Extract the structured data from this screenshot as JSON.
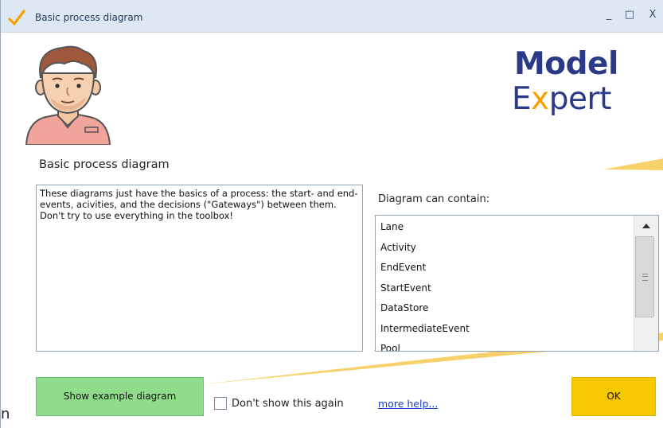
{
  "window": {
    "title": "Basic process diagram",
    "controls": {
      "minimize": "_",
      "maximize": "□",
      "close": "X"
    }
  },
  "logo": {
    "line1": "Model",
    "line2": "Expert",
    "text_color": "#2b3a86",
    "accent_color": "#f5a300"
  },
  "main": {
    "heading": "Basic process diagram",
    "description": "These diagrams just have the basics of a process: the start- and end-events, acivities, and the decisions (\"Gateways\") between them. Don't try to use everything in the toolbox!",
    "contain_label": "Diagram can contain:",
    "contain_items": [
      "Lane",
      "Activity",
      "EndEvent",
      "StartEvent",
      "DataStore",
      "IntermediateEvent",
      "Pool"
    ]
  },
  "footer": {
    "example_button": "Show example diagram",
    "dont_show_label": "Don't show this again",
    "dont_show_checked": false,
    "more_help": "more help...",
    "ok_button": "OK"
  },
  "edge_fragment": "n",
  "colors": {
    "titlebar_bg": "#dde8f4",
    "example_button_bg": "#8fdc8a",
    "ok_button_bg": "#f5c800",
    "link": "#1a3fc8",
    "callout": "#f7d26a"
  },
  "icons": {
    "title_icon": "checkmark-icon",
    "avatar": "man-avatar-illustration"
  }
}
